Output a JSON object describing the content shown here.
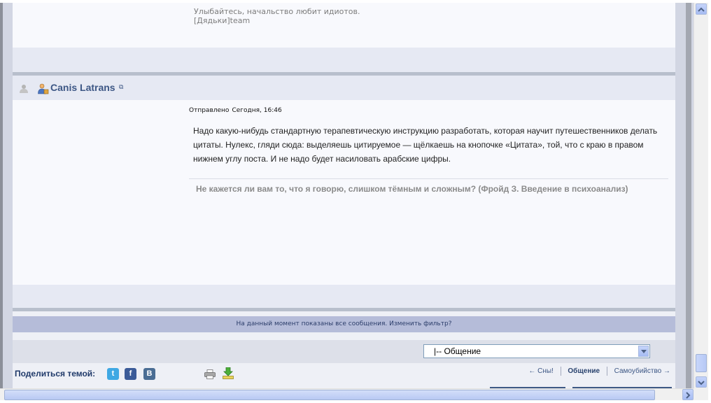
{
  "prev_post": {
    "signature_line1": "Улыбайтесь, начальство любит идиотов.",
    "signature_line2": "[Дядьки]team"
  },
  "post": {
    "author": "Canis Latrans",
    "posted_label": "Отправлено",
    "posted_time": "Сегодня, 16:46",
    "text_paragraphs": [
      "Надо какую-нибудь стандартную терапевтическую инструкцию разработать, которая научит путешественников делать цитаты. Нулекс, гляди сюда: выделяешь цитируемое — щёлкаешь на кнопочке «Цитата», той, что с краю в правом нижнем углу поста. И не надо будет насиловать арабские цифры."
    ],
    "signature": "Не кажется ли вам то, что я говорю, слишком тёмным и сложным? (Фройд З. Введение в психоанализ)"
  },
  "filter_notice": "На данный момент показаны все сообщения. Изменить фильтр?",
  "forum_jump": {
    "selected": "|-- Общение"
  },
  "share": {
    "label": "Поделиться темой:",
    "twitter": "t",
    "facebook": "f",
    "vkontakte": "B"
  },
  "topic_nav": {
    "prev": "← Сны!",
    "current": "Общение",
    "next": "Самоубийство →"
  },
  "colors": {
    "accent": "#3d5785",
    "filter_bar": "#b5bcd9"
  }
}
